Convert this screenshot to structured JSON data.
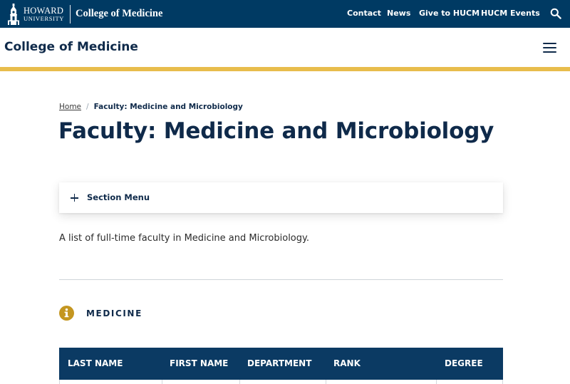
{
  "topbar": {
    "logo_line1": "HOWARD",
    "logo_line2": "UNIVERSITY",
    "logo_college": "College of Medicine",
    "nav": [
      "Contact",
      "News",
      "Give to HUCM",
      "HUCM Events"
    ],
    "search_icon": "search-icon"
  },
  "header": {
    "site_title": "College of Medicine",
    "menu_icon": "hamburger-menu-icon"
  },
  "colors": {
    "navy": "#003a63",
    "gold": "#e8bd4c",
    "title": "#0f2a4a",
    "info_icon": "#c49620"
  },
  "breadcrumb": {
    "home": "Home",
    "separator": "/",
    "current": "Faculty: Medicine and Microbiology"
  },
  "page": {
    "title": "Faculty: Medicine and Microbiology",
    "section_menu_label": "Section Menu",
    "intro": "A list of full-time faculty in Medicine and Microbiology.",
    "section_heading": "MEDICINE"
  },
  "table": {
    "columns": [
      "LAST NAME",
      "FIRST NAME",
      "DEPARTMENT",
      "RANK",
      "DEGREE"
    ]
  }
}
